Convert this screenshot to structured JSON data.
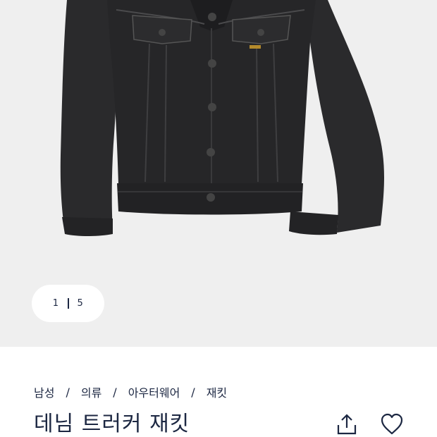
{
  "gallery": {
    "current_page": "1",
    "total_pages": "5",
    "image_subject": "black denim trucker jacket"
  },
  "breadcrumb": [
    "남성",
    "의류",
    "아우터웨어",
    "재킷"
  ],
  "breadcrumb_separator": "/",
  "product": {
    "title": "데님 트러커 재킷"
  },
  "icons": {
    "share": "share-icon",
    "wishlist": "heart-icon"
  },
  "colors": {
    "text": "#1c2742",
    "gallery_bg": "#efefef",
    "jacket": "#242426"
  }
}
